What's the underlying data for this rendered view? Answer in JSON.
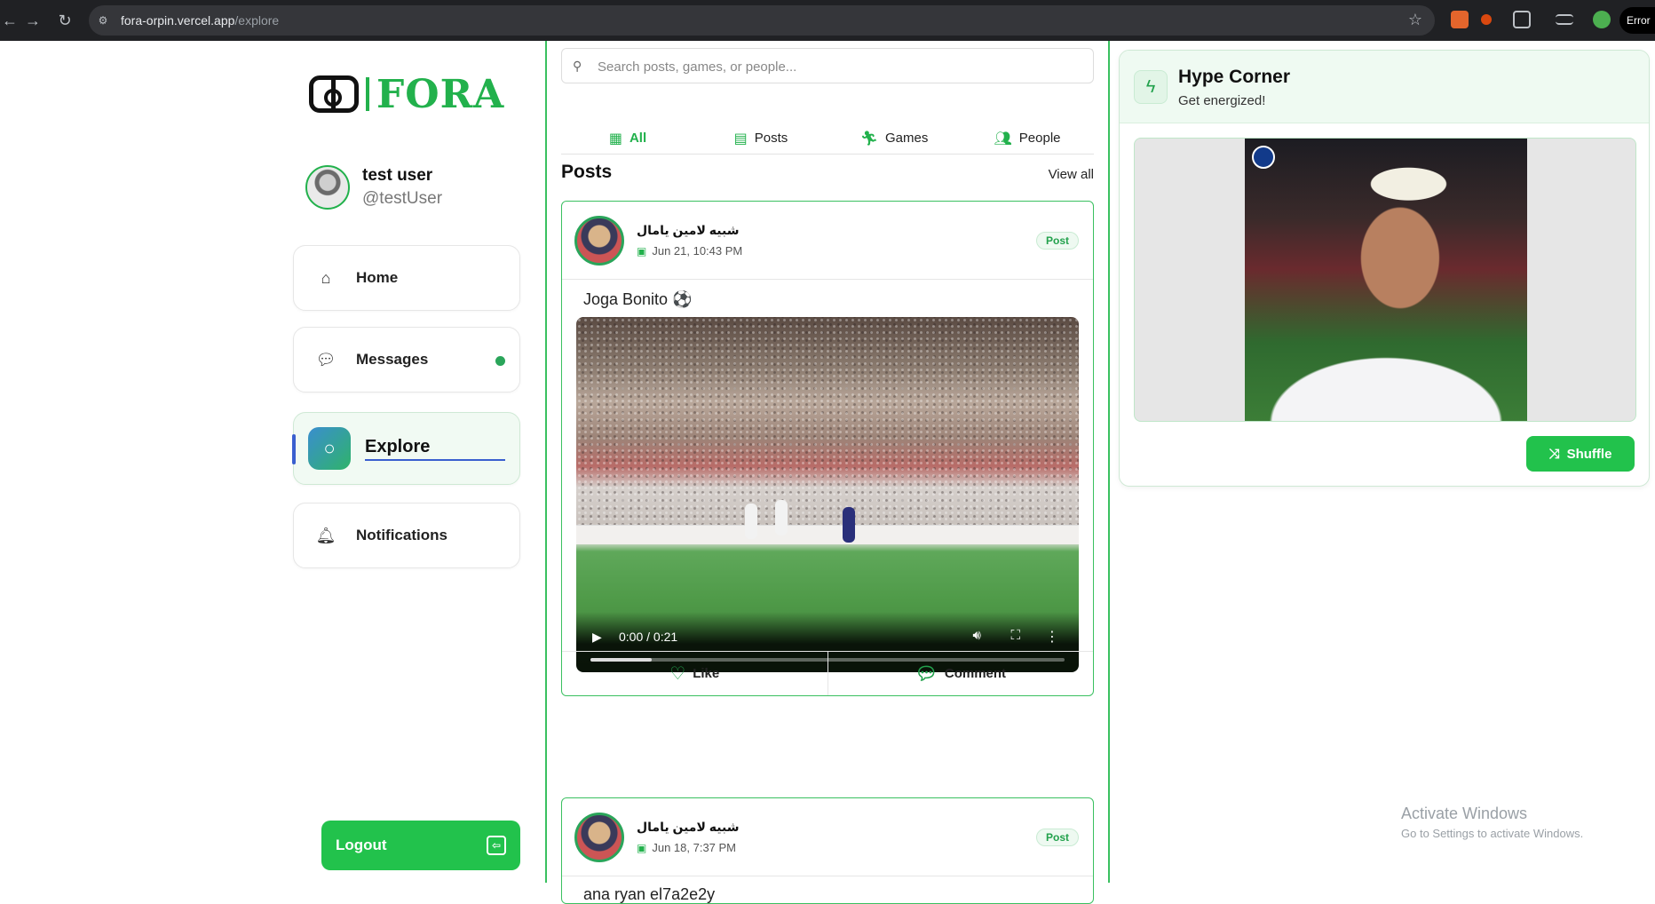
{
  "browser": {
    "url_host": "fora-orpin.vercel.app",
    "url_path": "/explore",
    "error_label": "Error"
  },
  "brand": {
    "name": "FORA",
    "accent": "#22b14c"
  },
  "profile": {
    "name": "test user",
    "handle": "@testUser"
  },
  "sidebar": {
    "items": [
      {
        "label": "Home",
        "icon": "home-icon"
      },
      {
        "label": "Messages",
        "icon": "message-icon",
        "has_unread_dot": true
      },
      {
        "label": "Explore",
        "icon": "search-icon",
        "active": true
      },
      {
        "label": "Notifications",
        "icon": "bell-icon"
      }
    ],
    "logout_label": "Logout"
  },
  "search": {
    "placeholder": "Search posts, games, or people..."
  },
  "tabs": [
    {
      "label": "All",
      "icon": "grid-icon",
      "active": true
    },
    {
      "label": "Posts",
      "icon": "posts-icon"
    },
    {
      "label": "Games",
      "icon": "player-icon"
    },
    {
      "label": "People",
      "icon": "people-icon"
    }
  ],
  "section": {
    "title": "Posts",
    "view_all": "View all"
  },
  "posts": [
    {
      "author": "شبيه لامين يامال",
      "date": "Jun 21, 10:43 PM",
      "badge": "Post",
      "text": "Joga Bonito ⚽",
      "video": {
        "current_time": "0:00",
        "duration": "0:21",
        "time_display": "0:00 / 0:21",
        "buffered_fraction": 0.13
      },
      "actions": {
        "like": "Like",
        "comment": "Comment"
      }
    },
    {
      "author": "شبيه لامين يامال",
      "date": "Jun 18, 7:37 PM",
      "badge": "Post",
      "text": "ana ryan el7a2e2y"
    }
  ],
  "hype": {
    "title": "Hype Corner",
    "subtitle": "Get energized!",
    "shuffle_label": "Shuffle"
  },
  "windows_watermark": {
    "line1": "Activate Windows",
    "line2": "Go to Settings to activate Windows."
  }
}
